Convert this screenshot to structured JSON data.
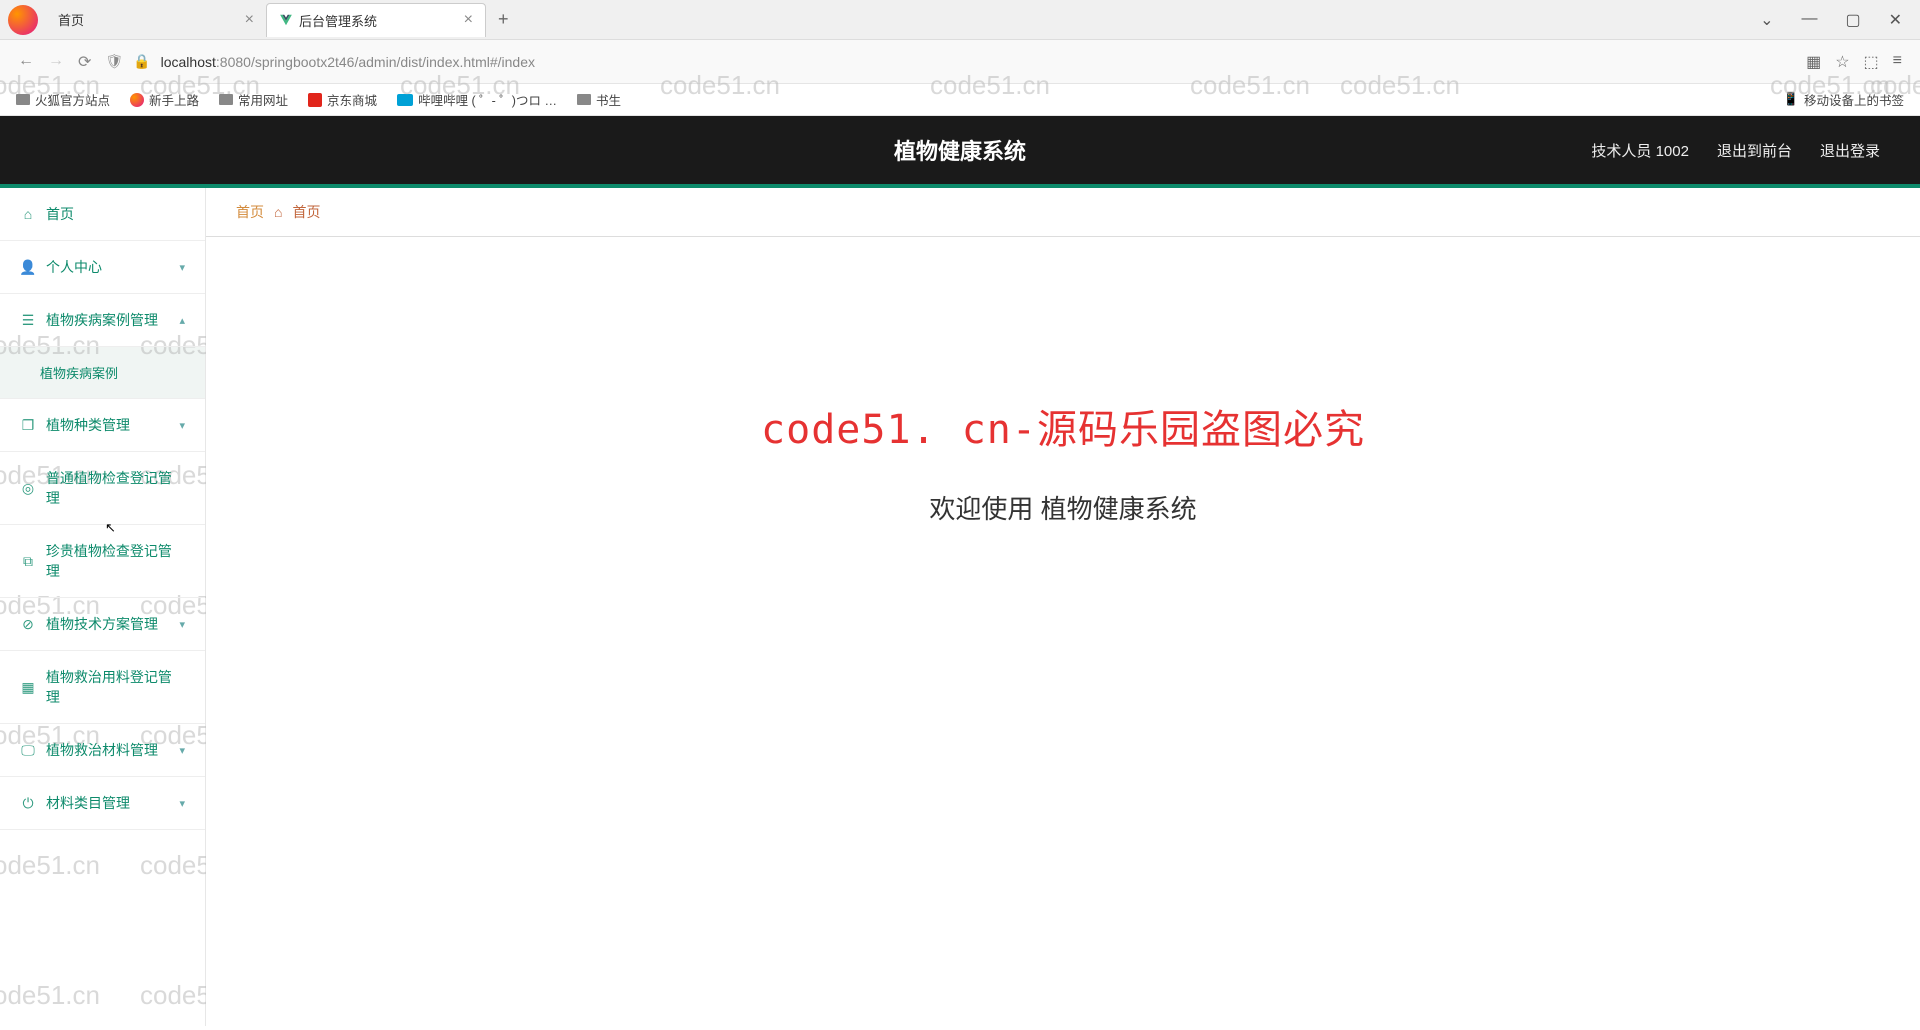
{
  "browser": {
    "tabs": [
      {
        "label": "首页"
      },
      {
        "label": "后台管理系统"
      }
    ],
    "url_host": "localhost",
    "url_port": ":8080",
    "url_path": "/springbootx2t46/admin/dist/index.html#/index",
    "window_controls": {
      "dropdown": "⌄",
      "min": "—",
      "max": "▢",
      "close": "✕"
    }
  },
  "bookmarks": {
    "items": [
      "火狐官方站点",
      "新手上路",
      "常用网址",
      "京东商城",
      "哔哩哔哩 (  ゜- ゜)つロ …",
      "书生"
    ],
    "right": "移动设备上的书签"
  },
  "header": {
    "title": "植物健康系统",
    "user": "技术人员 1002",
    "exit_front": "退出到前台",
    "logout": "退出登录"
  },
  "sidebar": {
    "items": [
      {
        "label": "首页",
        "icon": "home"
      },
      {
        "label": "个人中心",
        "icon": "person",
        "chev": "down"
      },
      {
        "label": "植物疾病案例管理",
        "icon": "list",
        "chev": "up",
        "sub": "植物疾病案例"
      },
      {
        "label": "植物种类管理",
        "icon": "copy",
        "chev": "down"
      },
      {
        "label": "普通植物检查登记管理",
        "icon": "target"
      },
      {
        "label": "珍贵植物检查登记管理",
        "icon": "crop"
      },
      {
        "label": "植物技术方案管理",
        "icon": "slash",
        "chev": "down"
      },
      {
        "label": "植物救治用料登记管理",
        "icon": "grid"
      },
      {
        "label": "植物救治材料管理",
        "icon": "monitor",
        "chev": "down"
      },
      {
        "label": "材料类目管理",
        "icon": "power",
        "chev": "down"
      }
    ]
  },
  "breadcrumb": {
    "first": "首页",
    "second": "首页"
  },
  "content": {
    "watermark_big": "code51. cn-源码乐园盗图必究",
    "welcome": "欢迎使用 植物健康系统"
  },
  "watermark": "code51.cn"
}
